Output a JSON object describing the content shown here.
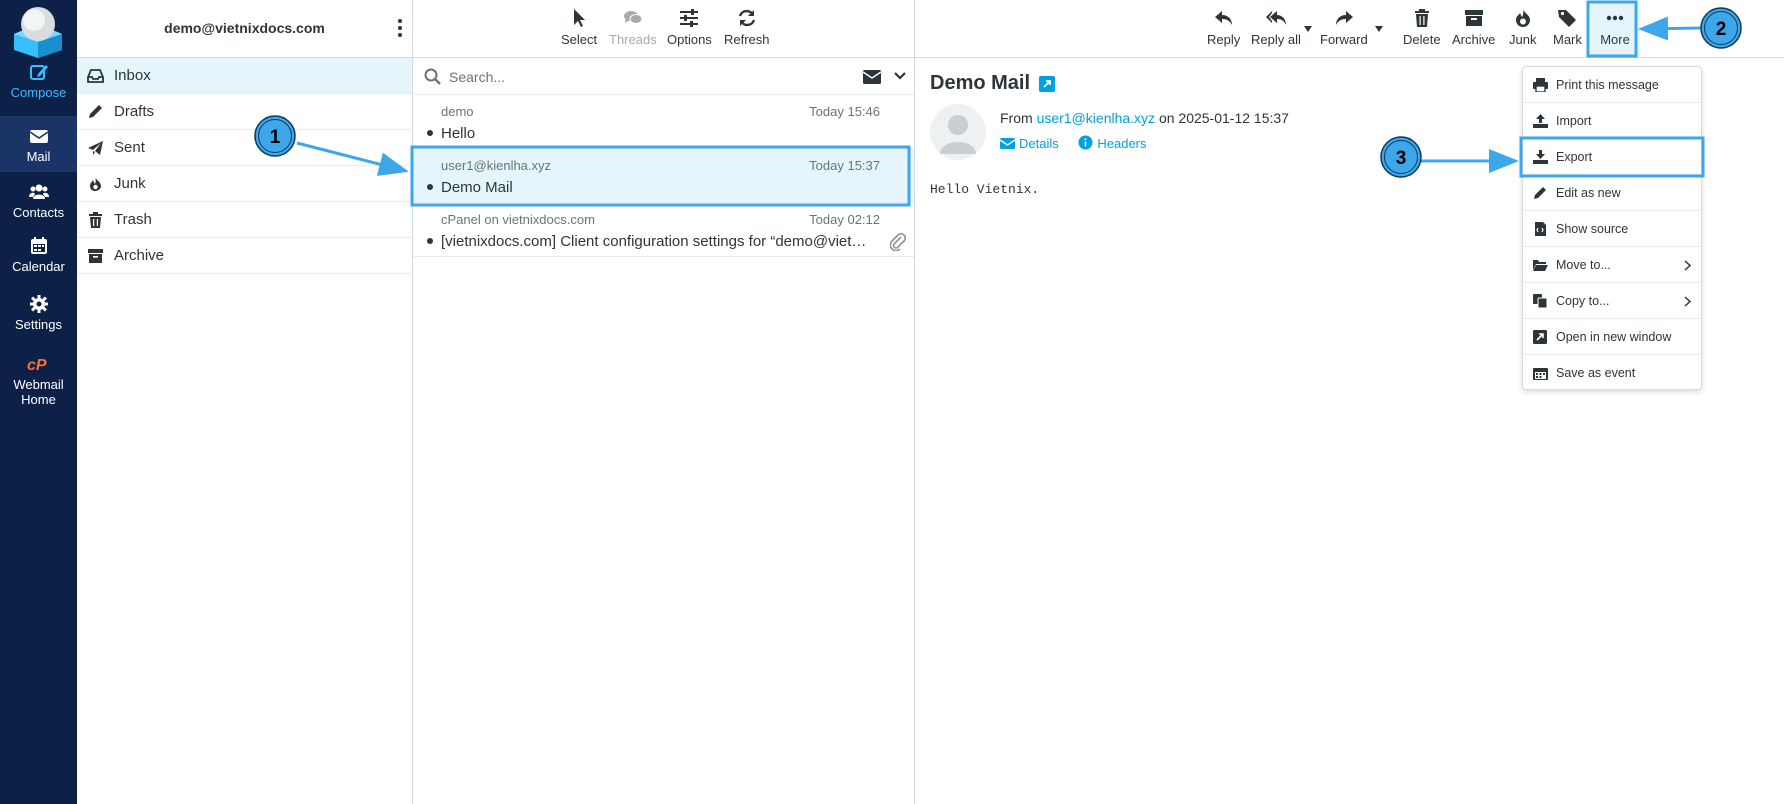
{
  "nav": {
    "compose": "Compose",
    "mail": "Mail",
    "contacts": "Contacts",
    "calendar": "Calendar",
    "settings": "Settings",
    "webmail_home_1": "Webmail",
    "webmail_home_2": "Home"
  },
  "account": "demo@vietnixdocs.com",
  "folders": [
    {
      "name": "Inbox",
      "icon": "inbox-icon",
      "selected": true
    },
    {
      "name": "Drafts",
      "icon": "pencil-icon"
    },
    {
      "name": "Sent",
      "icon": "paper-plane-icon"
    },
    {
      "name": "Junk",
      "icon": "fire-icon"
    },
    {
      "name": "Trash",
      "icon": "trash-icon"
    },
    {
      "name": "Archive",
      "icon": "archive-icon"
    }
  ],
  "list_toolbar": {
    "select": "Select",
    "threads": "Threads",
    "options": "Options",
    "refresh": "Refresh"
  },
  "search": {
    "placeholder": "Search..."
  },
  "messages": [
    {
      "from": "demo",
      "time": "Today 15:46",
      "subject": "Hello"
    },
    {
      "from": "user1@kienlha.xyz",
      "time": "Today 15:37",
      "subject": "Demo Mail",
      "selected": true
    },
    {
      "from": "cPanel on vietnixdocs.com",
      "time": "Today 02:12",
      "subject": "[vietnixdocs.com] Client configuration settings for “demo@vietnixdocs.com”",
      "attachment": true
    }
  ],
  "view_toolbar": {
    "reply": "Reply",
    "reply_all": "Reply all",
    "forward": "Forward",
    "delete": "Delete",
    "archive": "Archive",
    "junk": "Junk",
    "mark": "Mark",
    "more": "More"
  },
  "message": {
    "subject": "Demo Mail",
    "from_prefix": "From",
    "from_address": "user1@kienlha.xyz",
    "on_date": "on 2025-01-12 15:37",
    "details": "Details",
    "headers": "Headers",
    "body": "Hello Vietnix."
  },
  "more_menu": [
    {
      "label": "Print this message",
      "icon": "print-icon"
    },
    {
      "label": "Import",
      "icon": "upload-icon"
    },
    {
      "label": "Export",
      "icon": "download-icon"
    },
    {
      "label": "Edit as new",
      "icon": "pencil-icon"
    },
    {
      "label": "Show source",
      "icon": "source-file-icon"
    },
    {
      "label": "Move to...",
      "icon": "folder-open-icon",
      "submenu": true
    },
    {
      "label": "Copy to...",
      "icon": "copy-icon",
      "submenu": true
    },
    {
      "label": "Open in new window",
      "icon": "external-window-icon"
    },
    {
      "label": "Save as event",
      "icon": "calendar-icon"
    }
  ],
  "annotations": {
    "step1": "1",
    "step2": "2",
    "step3": "3",
    "accent": "#3ea6ea"
  },
  "colors": {
    "nav_bg": "#0d2148",
    "accent": "#00a1e1",
    "selected_row": "#e6f5fc"
  }
}
